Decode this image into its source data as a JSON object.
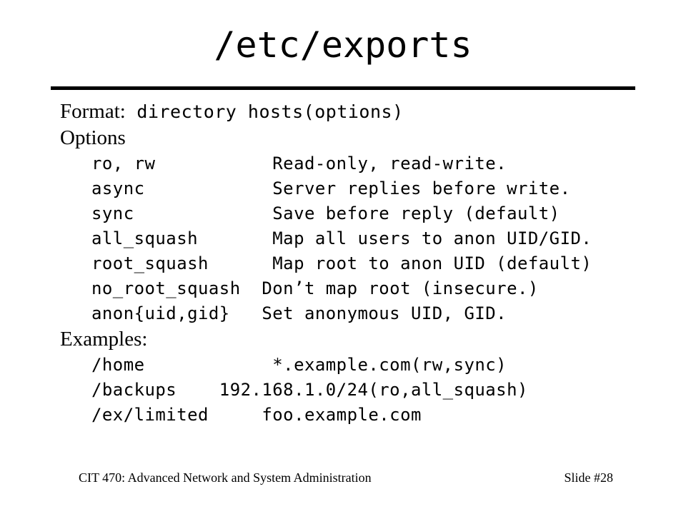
{
  "slide": {
    "title": "/etc/exports",
    "format": {
      "label": "Format:",
      "syntax": " directory   hosts(options)"
    },
    "options_heading": "Options",
    "options": [
      "ro, rw           Read-only, read-write.",
      "async            Server replies before write.",
      "sync             Save before reply (default)",
      "all_squash       Map all users to anon UID/GID.",
      "root_squash      Map root to anon UID (default)",
      "no_root_squash  Don’t map root (insecure.)",
      "anon{uid,gid}   Set anonymous UID, GID."
    ],
    "examples_heading": "Examples:",
    "examples": [
      "/home            *.example.com(rw,sync)",
      "/backups    192.168.1.0/24(ro,all_squash)",
      "/ex/limited     foo.example.com"
    ]
  },
  "footer": {
    "course": "CIT 470: Advanced Network and System Administration",
    "slide_number": "Slide #28"
  }
}
